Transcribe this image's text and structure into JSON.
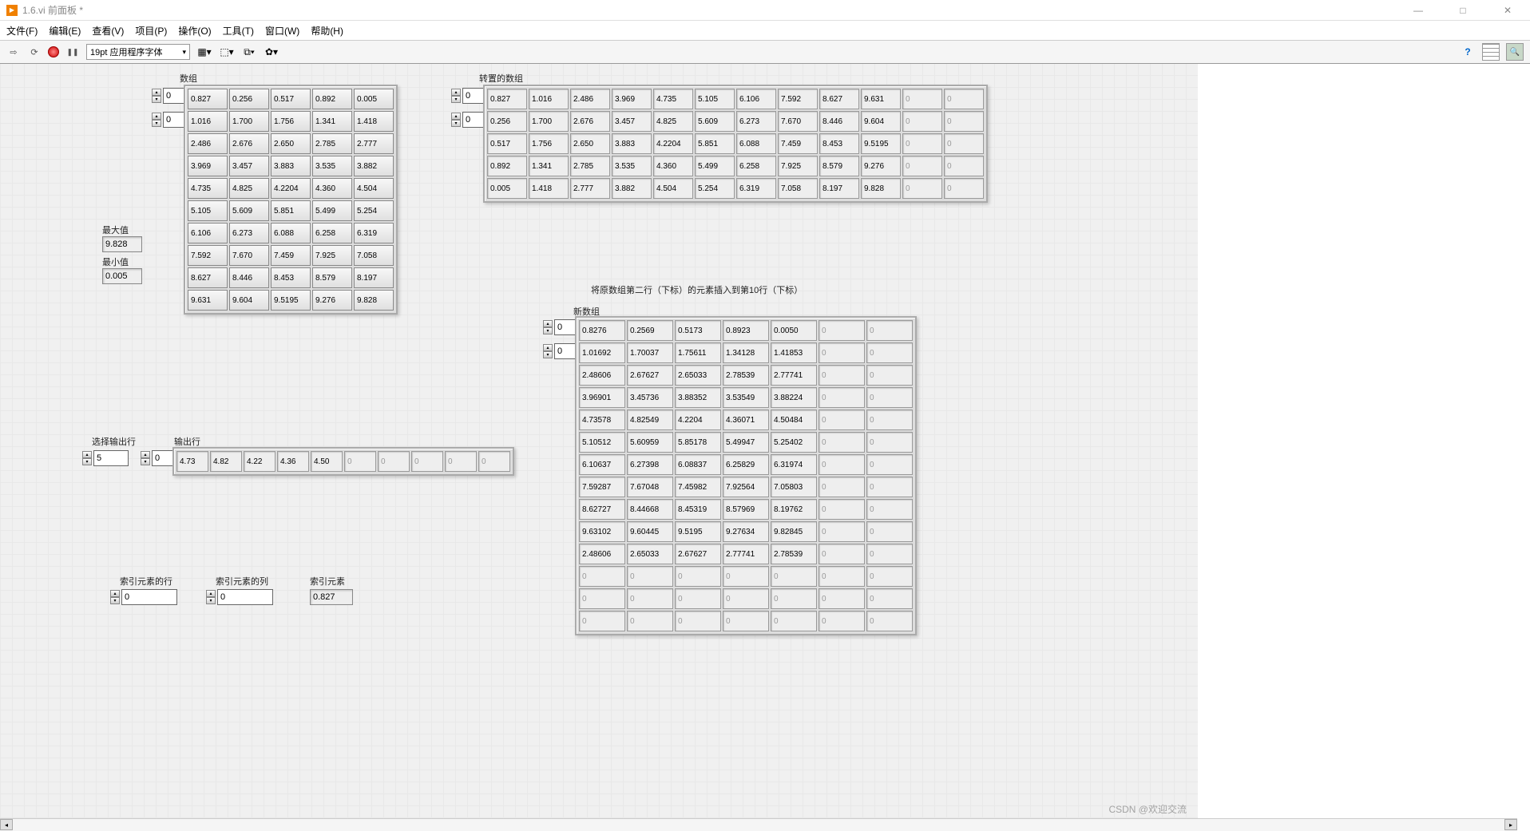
{
  "title": "1.6.vi 前面板 *",
  "menu": [
    "文件(F)",
    "编辑(E)",
    "查看(V)",
    "项目(P)",
    "操作(O)",
    "工具(T)",
    "窗口(W)",
    "帮助(H)"
  ],
  "font_selector": "19pt 应用程序字体",
  "labels": {
    "array": "数组",
    "transposed": "转置的数组",
    "max": "最大值",
    "min": "最小值",
    "insert_caption": "将原数组第二行（下标）的元素插入到第10行（下标）",
    "new_array": "新数组",
    "select_row": "选择输出行",
    "output_row": "输出行",
    "idx_row": "索引元素的行",
    "idx_col": "索引元素的列",
    "idx_elem": "索引元素"
  },
  "idx": {
    "a0": "0",
    "a1": "0",
    "t0": "0",
    "t1": "0",
    "n0": "0",
    "n1": "0",
    "out": "0",
    "sel": "5",
    "ir": "0",
    "ic": "0"
  },
  "max_val": "9.828",
  "min_val": "0.005",
  "idx_elem_val": "0.827",
  "array": [
    [
      "0.827",
      "0.256",
      "0.517",
      "0.892",
      "0.005"
    ],
    [
      "1.016",
      "1.700",
      "1.756",
      "1.341",
      "1.418"
    ],
    [
      "2.486",
      "2.676",
      "2.650",
      "2.785",
      "2.777"
    ],
    [
      "3.969",
      "3.457",
      "3.883",
      "3.535",
      "3.882"
    ],
    [
      "4.735",
      "4.825",
      "4.2204",
      "4.360",
      "4.504"
    ],
    [
      "5.105",
      "5.609",
      "5.851",
      "5.499",
      "5.254"
    ],
    [
      "6.106",
      "6.273",
      "6.088",
      "6.258",
      "6.319"
    ],
    [
      "7.592",
      "7.670",
      "7.459",
      "7.925",
      "7.058"
    ],
    [
      "8.627",
      "8.446",
      "8.453",
      "8.579",
      "8.197"
    ],
    [
      "9.631",
      "9.604",
      "9.5195",
      "9.276",
      "9.828"
    ]
  ],
  "transposed": [
    [
      "0.827",
      "1.016",
      "2.486",
      "3.969",
      "4.735",
      "5.105",
      "6.106",
      "7.592",
      "8.627",
      "9.631",
      "0",
      "0"
    ],
    [
      "0.256",
      "1.700",
      "2.676",
      "3.457",
      "4.825",
      "5.609",
      "6.273",
      "7.670",
      "8.446",
      "9.604",
      "0",
      "0"
    ],
    [
      "0.517",
      "1.756",
      "2.650",
      "3.883",
      "4.2204",
      "5.851",
      "6.088",
      "7.459",
      "8.453",
      "9.5195",
      "0",
      "0"
    ],
    [
      "0.892",
      "1.341",
      "2.785",
      "3.535",
      "4.360",
      "5.499",
      "6.258",
      "7.925",
      "8.579",
      "9.276",
      "0",
      "0"
    ],
    [
      "0.005",
      "1.418",
      "2.777",
      "3.882",
      "4.504",
      "5.254",
      "6.319",
      "7.058",
      "8.197",
      "9.828",
      "0",
      "0"
    ]
  ],
  "new_array": [
    [
      "0.8276",
      "0.2569",
      "0.5173",
      "0.8923",
      "0.0050",
      "0",
      "0"
    ],
    [
      "1.01692",
      "1.70037",
      "1.75611",
      "1.34128",
      "1.41853",
      "0",
      "0"
    ],
    [
      "2.48606",
      "2.67627",
      "2.65033",
      "2.78539",
      "2.77741",
      "0",
      "0"
    ],
    [
      "3.96901",
      "3.45736",
      "3.88352",
      "3.53549",
      "3.88224",
      "0",
      "0"
    ],
    [
      "4.73578",
      "4.82549",
      "4.2204",
      "4.36071",
      "4.50484",
      "0",
      "0"
    ],
    [
      "5.10512",
      "5.60959",
      "5.85178",
      "5.49947",
      "5.25402",
      "0",
      "0"
    ],
    [
      "6.10637",
      "6.27398",
      "6.08837",
      "6.25829",
      "6.31974",
      "0",
      "0"
    ],
    [
      "7.59287",
      "7.67048",
      "7.45982",
      "7.92564",
      "7.05803",
      "0",
      "0"
    ],
    [
      "8.62727",
      "8.44668",
      "8.45319",
      "8.57969",
      "8.19762",
      "0",
      "0"
    ],
    [
      "9.63102",
      "9.60445",
      "9.5195",
      "9.27634",
      "9.82845",
      "0",
      "0"
    ],
    [
      "2.48606",
      "2.65033",
      "2.67627",
      "2.77741",
      "2.78539",
      "0",
      "0"
    ],
    [
      "0",
      "0",
      "0",
      "0",
      "0",
      "0",
      "0"
    ],
    [
      "0",
      "0",
      "0",
      "0",
      "0",
      "0",
      "0"
    ],
    [
      "0",
      "0",
      "0",
      "0",
      "0",
      "0",
      "0"
    ]
  ],
  "output_row": [
    "4.73",
    "4.82",
    "4.22",
    "4.36",
    "4.50",
    "0",
    "0",
    "0",
    "0",
    "0"
  ],
  "watermark": "CSDN @欢迎交流"
}
